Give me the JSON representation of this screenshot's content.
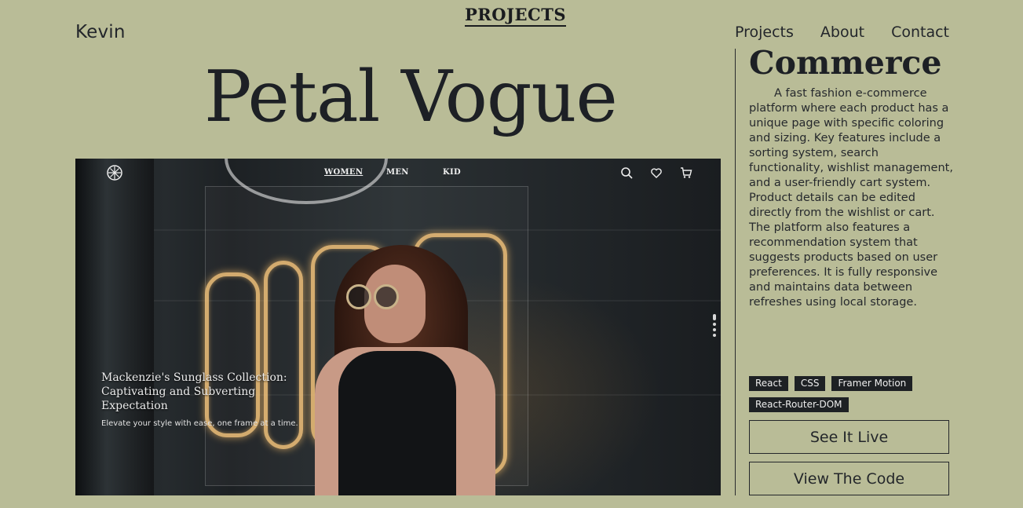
{
  "header": {
    "logo_name": "Kevin",
    "page_heading": "PROJECTS",
    "nav": [
      "Projects",
      "About",
      "Contact"
    ]
  },
  "project": {
    "title": "Petal Vogue",
    "category": "Commerce",
    "description": "A fast fashion e-commerce platform where each product has a unique page with specific coloring and sizing. Key features include a sorting system, search functionality, wishlist management, and a user-friendly cart system. Product details can be edited directly from the wishlist or cart. The platform also features a recommendation system that suggests products based on user preferences. It is fully responsive and maintains data between refreshes using local storage.",
    "tags": [
      "React",
      "CSS",
      "Framer Motion",
      "React-Router-DOM"
    ],
    "live_label": "See It Live",
    "code_label": "View The Code"
  },
  "preview": {
    "nav_links": [
      "WOMEN",
      "MEN",
      "KID"
    ],
    "icons": [
      "search-icon",
      "heart-icon",
      "cart-icon"
    ],
    "hero_heading": "Mackenzie's Sunglass Collection: Captivating and Subverting Expectation",
    "hero_subtext": "Elevate your style with ease, one frame at a time."
  },
  "colors": {
    "background": "#b9bc97",
    "text": "#1f2226",
    "tag_bg": "#1e2124"
  }
}
